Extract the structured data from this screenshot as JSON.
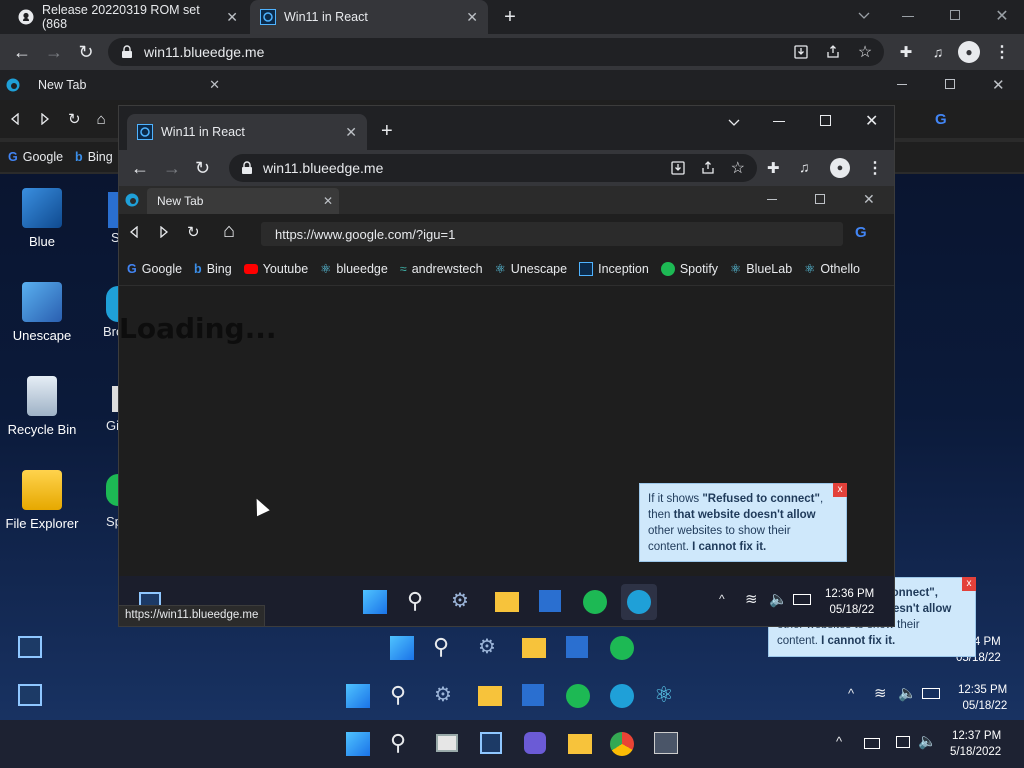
{
  "outer": {
    "tabs": [
      {
        "title": "Release 20220319 ROM set (868",
        "icon": "github-icon"
      },
      {
        "title": "Win11 in React",
        "icon": "win11react-icon"
      }
    ],
    "url": "win11.blueedge.me"
  },
  "back_edge": {
    "tab_title": "New Tab",
    "bookmarks": [
      "Google",
      "Bing"
    ]
  },
  "desktop": {
    "icons": [
      "Blue",
      "Unescape",
      "Recycle Bin",
      "File Explorer"
    ],
    "partial_labels": [
      "S",
      "Bro",
      "Gi",
      "Sp"
    ]
  },
  "front": {
    "tab_title": "Win11 in React",
    "url": "win11.blueedge.me",
    "edge_tab_title": "New Tab",
    "edge_url": "https://www.google.com/?igu=1",
    "bookmarks": [
      "Google",
      "Bing",
      "Youtube",
      "blueedge",
      "andrewstech",
      "Unescape",
      "Inception",
      "Spotify",
      "BlueLab",
      "Othello"
    ],
    "loading_text": "Loading...",
    "status_url": "https://win11.blueedge.me",
    "clock_time": "12:36 PM",
    "clock_date": "05/18/22"
  },
  "tooltip": {
    "line1_pre": "If it shows ",
    "line1_bold": "\"Refused to connect\"",
    "line1_post": ",",
    "line2_pre": "then ",
    "line2_bold": "that website doesn't allow",
    "line3": "other websites to show their",
    "line4_pre": "content. ",
    "line4_bold": "I cannot fix it."
  },
  "back_tooltip": {
    "line1": "o connect\",",
    "line2": "esn't allow",
    "line3": "other websites to show their",
    "line4_pre": "content. ",
    "line4_bold": "I cannot fix it."
  },
  "taskbars": {
    "clock2_time": "4 PM",
    "clock2_date": "05/18/22",
    "clock3_time": "12:35 PM",
    "clock3_date": "05/18/22",
    "clock4_time": "12:37 PM",
    "clock4_date": "5/18/2022"
  },
  "colors": {
    "accent": "#1a73e8",
    "tooltip_bg": "#cfe8fb",
    "close_red": "#e3413a"
  }
}
